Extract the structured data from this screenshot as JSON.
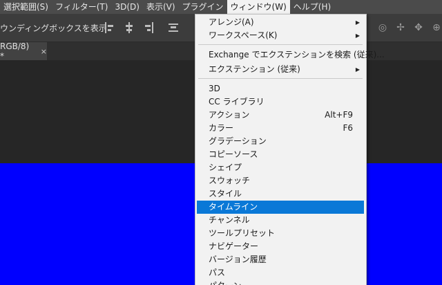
{
  "menubar": {
    "items": [
      "選択範囲(S)",
      "フィルター(T)",
      "3D(D)",
      "表示(V)",
      "プラグイン",
      "ウィンドウ(W)",
      "ヘルプ(H)"
    ],
    "active_index": 5
  },
  "options": {
    "bounding_label": "ウンディングボックスを表示"
  },
  "tab": {
    "title": "RGB/8) *",
    "close": "×"
  },
  "colors": {
    "canvas": "#0000ff",
    "highlight": "#0a78d7"
  },
  "window_menu": {
    "items": [
      {
        "label": "アレンジ(A)",
        "submenu": true
      },
      {
        "label": "ワークスペース(K)",
        "submenu": true
      },
      {
        "label": "Exchange でエクステンションを検索 (従来)...",
        "submenu": false
      },
      {
        "label": "エクステンション (従来)",
        "submenu": true
      },
      {
        "label": "3D"
      },
      {
        "label": "CC ライブラリ"
      },
      {
        "label": "アクション",
        "shortcut": "Alt+F9"
      },
      {
        "label": "カラー",
        "shortcut": "F6"
      },
      {
        "label": "グラデーション"
      },
      {
        "label": "コピーソース"
      },
      {
        "label": "シェイプ"
      },
      {
        "label": "スウォッチ"
      },
      {
        "label": "スタイル"
      },
      {
        "label": "タイムライン",
        "highlighted": true
      },
      {
        "label": "チャンネル"
      },
      {
        "label": "ツールプリセット"
      },
      {
        "label": "ナビゲーター"
      },
      {
        "label": "バージョン履歴"
      },
      {
        "label": "パス"
      },
      {
        "label": "パターン"
      }
    ]
  }
}
